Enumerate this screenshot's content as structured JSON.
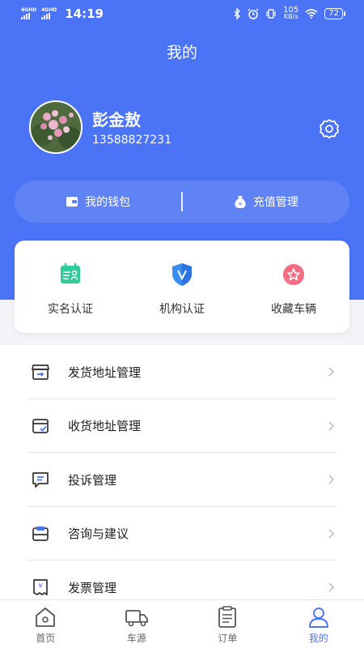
{
  "status_bar": {
    "signal1": "4GHD",
    "signal2": "4GHD",
    "time": "14:19",
    "net_speed_value": "105",
    "net_speed_unit": "KB/s",
    "battery": "72"
  },
  "header": {
    "title": "我的"
  },
  "profile": {
    "name": "彭金敖",
    "phone": "13588827231"
  },
  "wallet_bar": {
    "wallet_label": "我的钱包",
    "recharge_label": "充值管理"
  },
  "quick_actions": [
    {
      "label": "实名认证",
      "icon": "id-card-icon"
    },
    {
      "label": "机构认证",
      "icon": "shield-v-icon"
    },
    {
      "label": "收藏车辆",
      "icon": "star-badge-icon"
    }
  ],
  "menu": [
    {
      "label": "发货地址管理",
      "icon": "ship-box-icon"
    },
    {
      "label": "收货地址管理",
      "icon": "receive-box-icon"
    },
    {
      "label": "投诉管理",
      "icon": "chat-icon"
    },
    {
      "label": "咨询与建议",
      "icon": "consult-icon"
    },
    {
      "label": "发票管理",
      "icon": "invoice-icon"
    }
  ],
  "tabs": [
    {
      "label": "首页",
      "icon": "home-icon",
      "active": false
    },
    {
      "label": "车源",
      "icon": "truck-icon",
      "active": false
    },
    {
      "label": "订单",
      "icon": "clipboard-icon",
      "active": false
    },
    {
      "label": "我的",
      "icon": "user-icon",
      "active": true
    }
  ],
  "colors": {
    "primary": "#4a73f5",
    "wallet_bar": "#5f83f5",
    "page_bg": "#f3f4f7",
    "active_tab": "#4a73f5"
  }
}
